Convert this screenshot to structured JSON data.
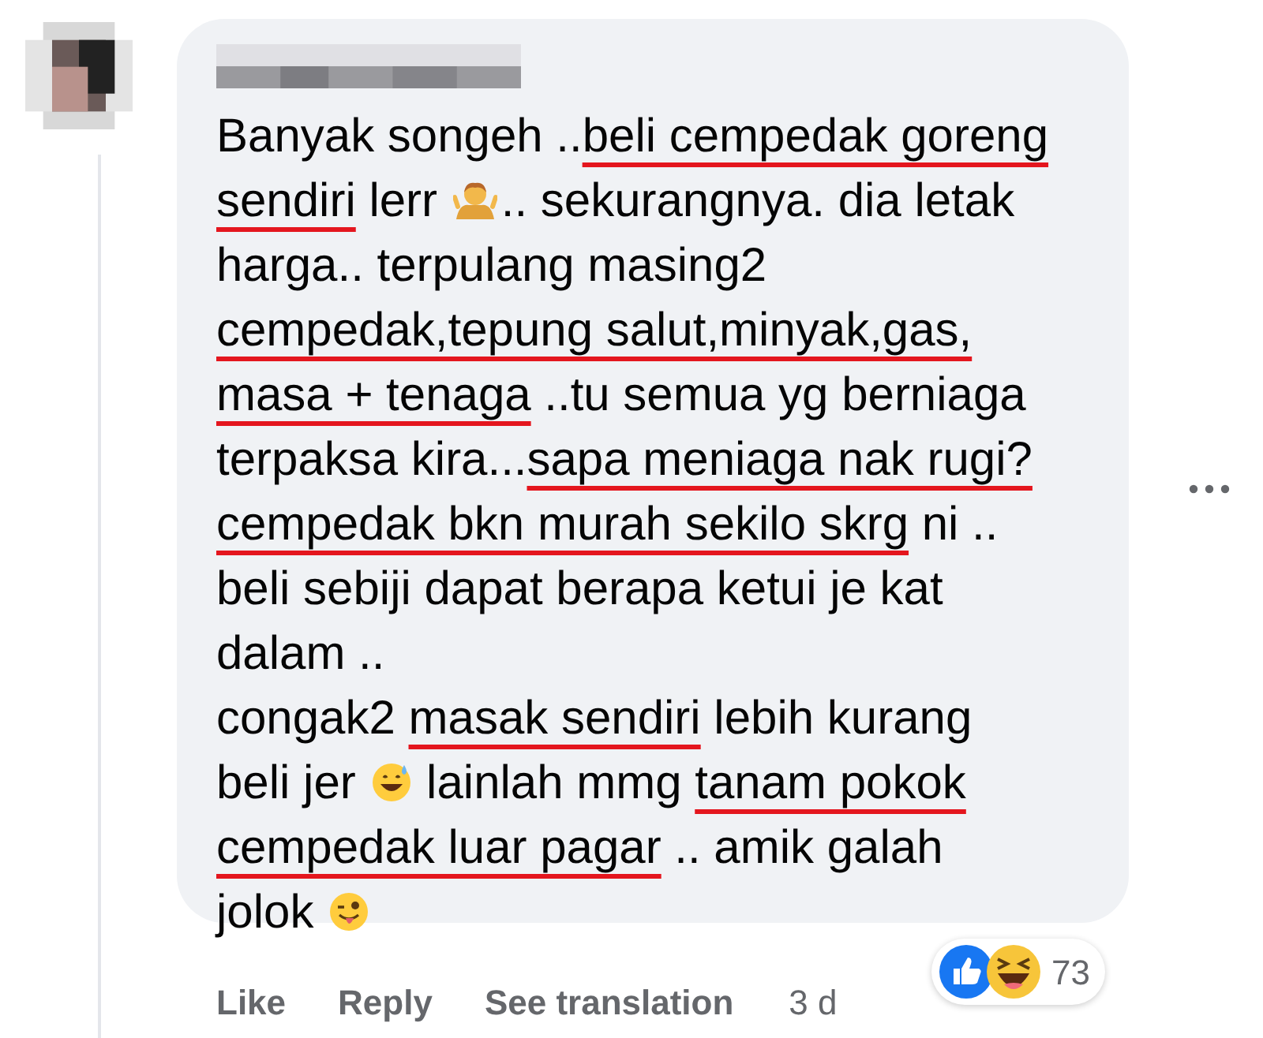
{
  "comment": {
    "lines": [
      [
        {
          "kind": "text",
          "text": "Banyak songeh ..",
          "underlined": false
        },
        {
          "kind": "text",
          "text": "beli cempedak goreng",
          "underlined": true
        }
      ],
      [
        {
          "kind": "text",
          "text": "sendiri",
          "underlined": true
        },
        {
          "kind": "text",
          "text": " lerr ",
          "underlined": false
        },
        {
          "kind": "shrug"
        },
        {
          "kind": "text",
          "text": ".. sekurangnya. dia letak",
          "underlined": false
        }
      ],
      [
        {
          "kind": "text",
          "text": "harga.. terpulang masing2",
          "underlined": false
        }
      ],
      [
        {
          "kind": "text",
          "text": "cempedak,tepung salut,minyak,gas,",
          "underlined": true
        }
      ],
      [
        {
          "kind": "text",
          "text": "masa + tenaga",
          "underlined": true
        },
        {
          "kind": "text",
          "text": " ..tu semua yg berniaga",
          "underlined": false
        }
      ],
      [
        {
          "kind": "text",
          "text": "terpaksa kira...",
          "underlined": false
        },
        {
          "kind": "text",
          "text": "sapa meniaga nak rugi?",
          "underlined": true
        }
      ],
      [
        {
          "kind": "text",
          "text": "cempedak bkn murah sekilo skrg",
          "underlined": true
        },
        {
          "kind": "text",
          "text": " ni ..",
          "underlined": false
        }
      ],
      [
        {
          "kind": "text",
          "text": "beli sebiji dapat berapa ketui je kat",
          "underlined": false
        }
      ],
      [
        {
          "kind": "text",
          "text": "dalam ..",
          "underlined": false
        }
      ],
      [
        {
          "kind": "text",
          "text": "congak2 ",
          "underlined": false
        },
        {
          "kind": "text",
          "text": "masak sendiri",
          "underlined": true
        },
        {
          "kind": "text",
          "text": " lebih kurang",
          "underlined": false
        }
      ],
      [
        {
          "kind": "text",
          "text": "beli jer ",
          "underlined": false
        },
        {
          "kind": "sweat"
        },
        {
          "kind": "text",
          "text": " lainlah mmg ",
          "underlined": false
        },
        {
          "kind": "text",
          "text": "tanam pokok",
          "underlined": true
        }
      ],
      [
        {
          "kind": "text",
          "text": "cempedak luar pagar",
          "underlined": true
        },
        {
          "kind": "text",
          "text": " .. amik galah",
          "underlined": false
        }
      ],
      [
        {
          "kind": "text",
          "text": "jolok ",
          "underlined": false
        },
        {
          "kind": "wink"
        }
      ]
    ]
  },
  "actions": [
    "Like",
    "Reply",
    "See translation"
  ],
  "time": "3 d",
  "reactions": {
    "count": "73"
  }
}
